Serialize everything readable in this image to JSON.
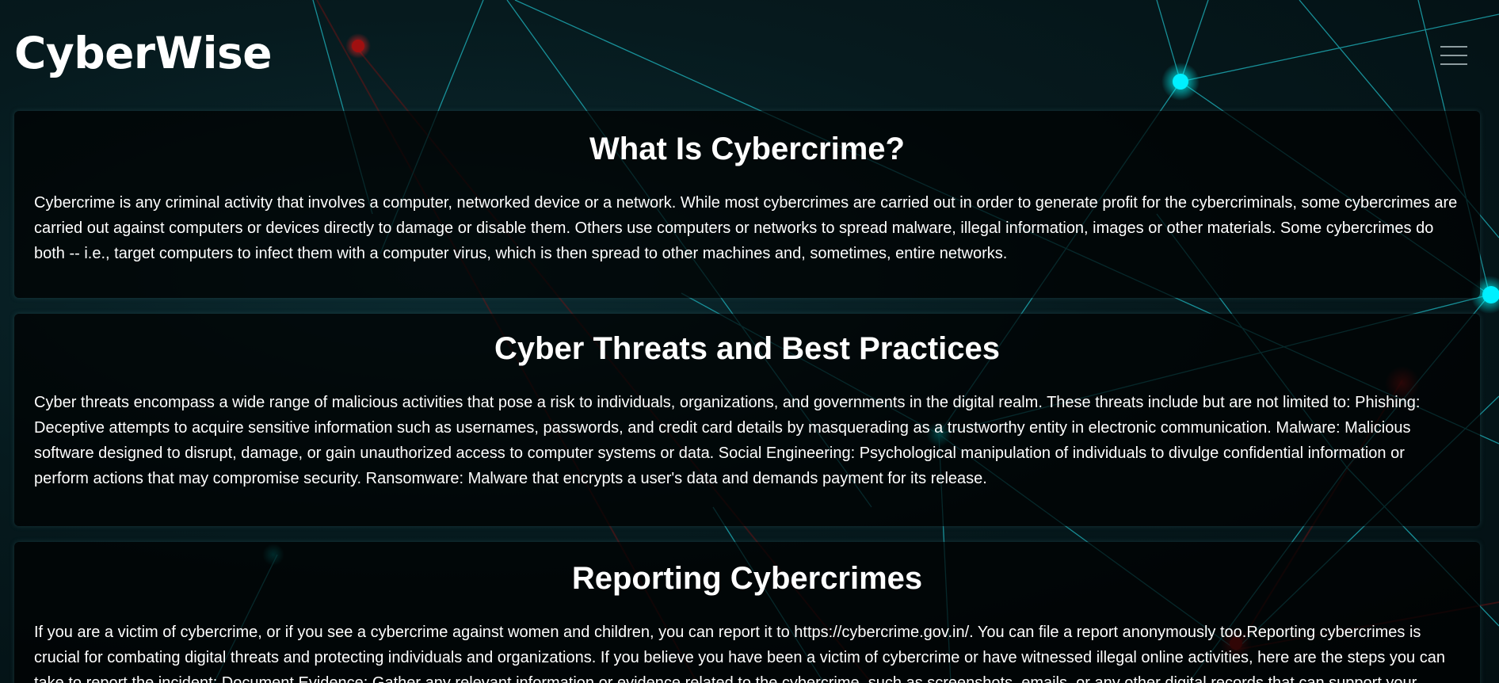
{
  "header": {
    "brand": "CyberWise",
    "menu_icon": "hamburger-menu-icon"
  },
  "sections": [
    {
      "title": "What Is Cybercrime?",
      "body": "Cybercrime is any criminal activity that involves a computer, networked device or a network. While most cybercrimes are carried out in order to generate profit for the cybercriminals, some cybercrimes are carried out against computers or devices directly to damage or disable them. Others use computers or networks to spread malware, illegal information, images or other materials. Some cybercrimes do both -- i.e., target computers to infect them with a computer virus, which is then spread to other machines and, sometimes, entire networks."
    },
    {
      "title": "Cyber Threats and Best Practices",
      "body": "Cyber threats encompass a wide range of malicious activities that pose a risk to individuals, organizations, and governments in the digital realm. These threats include but are not limited to: Phishing: Deceptive attempts to acquire sensitive information such as usernames, passwords, and credit card details by masquerading as a trustworthy entity in electronic communication. Malware: Malicious software designed to disrupt, damage, or gain unauthorized access to computer systems or data. Social Engineering: Psychological manipulation of individuals to divulge confidential information or perform actions that may compromise security. Ransomware: Malware that encrypts a user's data and demands payment for its release."
    },
    {
      "title": "Reporting Cybercrimes",
      "body": "If you are a victim of cybercrime, or if you see a cybercrime against women and children, you can report it to https://cybercrime.gov.in/. You can file a report anonymously too.Reporting cybercrimes is crucial for combating digital threats and protecting individuals and organizations. If you believe you have been a victim of cybercrime or have witnessed illegal online activities, here are the steps you can take to report the incident: Document Evidence: Gather any relevant information or evidence related to the cybercrime, such as screenshots, emails, or any other digital records that can support your"
    }
  ],
  "theme": {
    "background": "#05191d",
    "accent": "#00e5f0",
    "secondary_accent": "#b01818",
    "card_background": "#000000",
    "text": "#ffffff"
  }
}
